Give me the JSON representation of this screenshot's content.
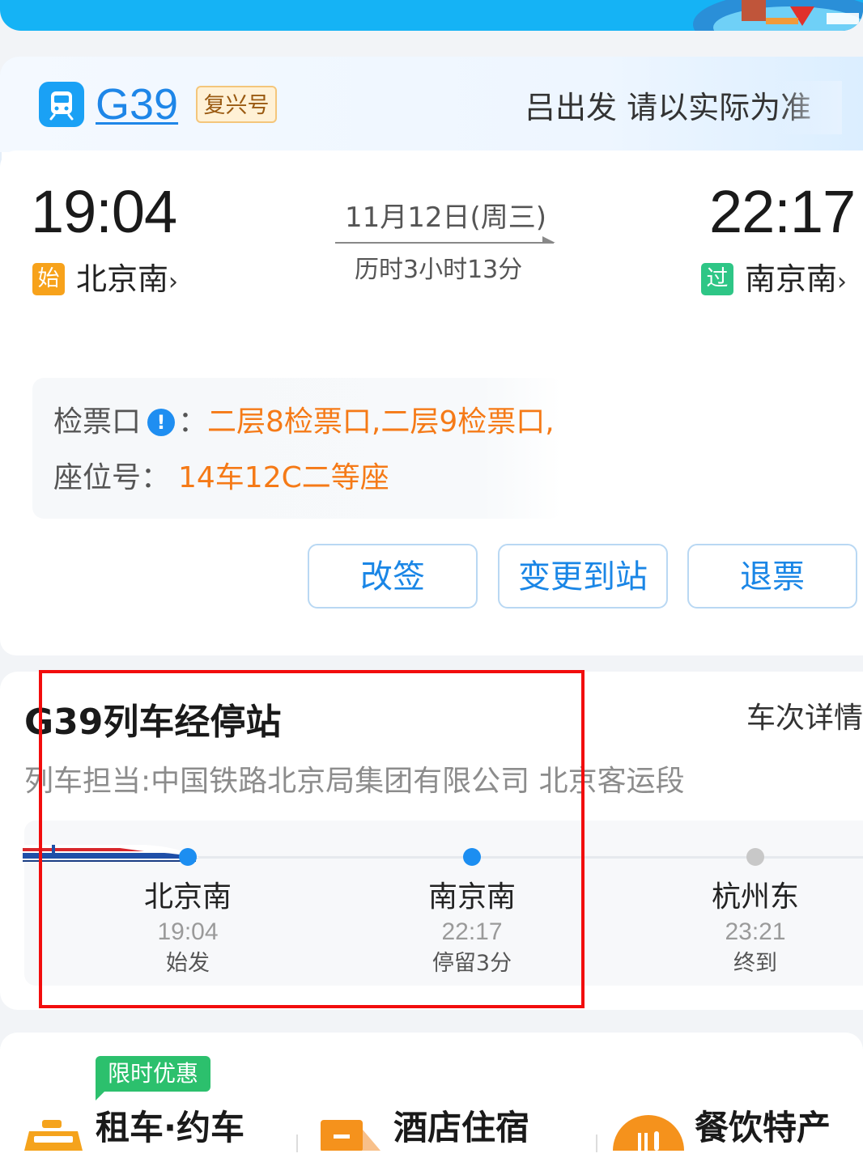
{
  "header": {
    "train_number": "G39",
    "train_type": "复兴号",
    "notice": "吕出发 请以实际为准"
  },
  "journey": {
    "departure_time": "19:04",
    "departure_badge": "始",
    "departure_station": "北京南",
    "date": "11月12日(周三)",
    "duration": "历时3小时13分",
    "arrival_time": "22:17",
    "arrival_badge": "过",
    "arrival_station": "南京南",
    "chevron": "›"
  },
  "info": {
    "gate_label": "检票口",
    "info_icon": "!",
    "colon": "：",
    "gate_value": "二层8检票口,二层9检票口,",
    "seat_label": "座位号：",
    "seat_value": "14车12C二等座"
  },
  "actions": {
    "change": "改签",
    "change_station": "变更到站",
    "refund": "退票"
  },
  "stops": {
    "title": "G39列车经停站",
    "detail_link": "车次详情",
    "operator": "列车担当:中国铁路北京局集团有限公司 北京客运段",
    "items": [
      {
        "name": "北京南",
        "time": "19:04",
        "note": "始发",
        "color": "#1c8ef1"
      },
      {
        "name": "南京南",
        "time": "22:17",
        "note": "停留3分",
        "color": "#1c8ef1"
      },
      {
        "name": "杭州东",
        "time": "23:21",
        "note": "终到",
        "color": "#c8c8c8"
      }
    ]
  },
  "services": {
    "promo": "限时优惠",
    "items": [
      "租车·约车",
      "酒店住宿",
      "餐饮特产"
    ]
  },
  "colors": {
    "accent_blue": "#1e86e8",
    "orange": "#f57a17",
    "green": "#2ec686",
    "highlight_red": "#f20d0d"
  }
}
